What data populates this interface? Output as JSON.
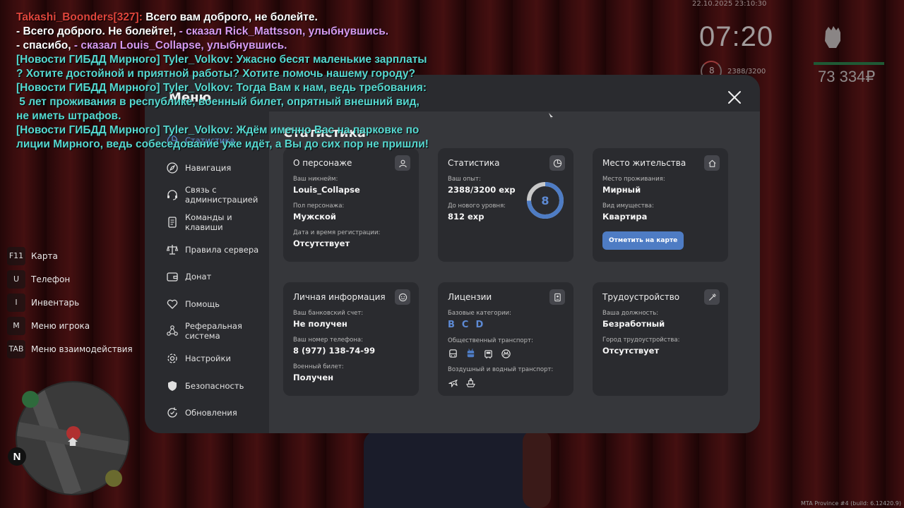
{
  "hud": {
    "datetime": "22.10.2025 23:10:30",
    "clock": "07:20",
    "level": "8",
    "exp": "2388/3200",
    "money": "73 334₽",
    "build": "MTA Province #4 (build: 6.12420.9)"
  },
  "chat": [
    {
      "parts": [
        {
          "text": "Takashi_Boonders[327]: ",
          "color": "red"
        },
        {
          "text": "Всего вам доброго, не болейте.",
          "color": "white"
        }
      ]
    },
    {
      "parts": [
        {
          "text": "- Всего доброго. Не болейте!, ",
          "color": "white"
        },
        {
          "text": "- сказал Rick_Mattsson, улыбнувшись.",
          "color": "purple"
        }
      ]
    },
    {
      "parts": [
        {
          "text": "- спасибо, ",
          "color": "white"
        },
        {
          "text": "- сказал Louis_Collapse, улыбнувшись.",
          "color": "purple"
        }
      ]
    },
    {
      "parts": [
        {
          "text": "[Новости ГИБДД Мирного] Tyler_Volkov: Ужасно бесят маленькие зарплаты",
          "color": "cyan"
        }
      ]
    },
    {
      "parts": [
        {
          "text": "? Хотите достойной и приятной работы? Хотите помочь нашему городу?",
          "color": "cyan"
        }
      ]
    },
    {
      "parts": [
        {
          "text": "[Новости ГИБДД Мирного] Tyler_Volkov: Тогда Вам к нам, ведь требования:",
          "color": "cyan"
        }
      ]
    },
    {
      "parts": [
        {
          "text": " 5 лет проживания в республике, военный билет, опрятный внешний вид,",
          "color": "cyan"
        }
      ]
    },
    {
      "parts": [
        {
          "text": "не иметь штрафов.",
          "color": "cyan"
        }
      ]
    },
    {
      "parts": [
        {
          "text": "[Новости ГИБДД Мирного] Tyler_Volkov: Ждём именно Вас на парковке по",
          "color": "cyan"
        }
      ]
    },
    {
      "parts": [
        {
          "text": "лиции Мирного, ведь собеседование уже идёт, а Вы до сих пор не пришли!",
          "color": "cyan"
        }
      ]
    }
  ],
  "hints": [
    {
      "key": "F11",
      "label": "Карта"
    },
    {
      "key": "U",
      "label": "Телефон"
    },
    {
      "key": "I",
      "label": "Инвентарь"
    },
    {
      "key": "M",
      "label": "Меню игрока"
    },
    {
      "key": "TAB",
      "label": "Меню взаимодействия"
    }
  ],
  "minimap": {
    "north": "N"
  },
  "menu": {
    "title": "Меню",
    "section_title": "Статистика",
    "sidebar": [
      {
        "label": "Статистика",
        "icon": "pie-chart-icon",
        "active": true
      },
      {
        "label": "Навигация",
        "icon": "compass-icon"
      },
      {
        "label": "Связь с администрацией",
        "icon": "headset-icon"
      },
      {
        "label": "Команды и клавиши",
        "icon": "document-icon"
      },
      {
        "label": "Правила сервера",
        "icon": "scales-icon"
      },
      {
        "label": "Донат",
        "icon": "wallet-icon"
      },
      {
        "label": "Помощь",
        "icon": "heart-hand-icon"
      },
      {
        "label": "Реферальная система",
        "icon": "network-icon"
      },
      {
        "label": "Настройки",
        "icon": "gear-icon"
      },
      {
        "label": "Безопасность",
        "icon": "shield-icon"
      },
      {
        "label": "Обновления",
        "icon": "refresh-icon"
      }
    ],
    "cards": {
      "persona": {
        "title": "О персонаже",
        "fields": [
          {
            "label": "Ваш никнейм:",
            "value": "Louis_Collapse"
          },
          {
            "label": "Пол персонажа:",
            "value": "Мужской"
          },
          {
            "label": "Дата и время регистрации:",
            "value": "Отсутствует"
          }
        ]
      },
      "stats": {
        "title": "Статистика",
        "fields": [
          {
            "label": "Ваш опыт:",
            "value": "2388/3200 exp"
          },
          {
            "label": "До нового уровня:",
            "value": "812 exp"
          }
        ],
        "level": "8",
        "progress": 0.746
      },
      "residence": {
        "title": "Место жительства",
        "fields": [
          {
            "label": "Место проживания:",
            "value": "Мирный"
          },
          {
            "label": "Вид имущества:",
            "value": "Квартира"
          }
        ],
        "button": "Отметить на карте"
      },
      "personal": {
        "title": "Личная информация",
        "fields": [
          {
            "label": "Ваш банковский счет:",
            "value": "Не получен"
          },
          {
            "label": "Ваш номер телефона:",
            "value": "8 (977) 138-74-99"
          },
          {
            "label": "Военный билет:",
            "value": "Получен"
          }
        ]
      },
      "licenses": {
        "title": "Лицензии",
        "base_label": "Базовые категории:",
        "categories": [
          "B",
          "C",
          "D"
        ],
        "public_label": "Общественный транспорт:",
        "public_icons": [
          "bus-icon",
          "trolleybus-icon",
          "tram-icon",
          "metro-icon"
        ],
        "air_label": "Воздушный и водный транспорт:",
        "air_icons": [
          "plane-icon",
          "boat-icon"
        ]
      },
      "job": {
        "title": "Трудоустройство",
        "fields": [
          {
            "label": "Ваша должность:",
            "value": "Безработный"
          },
          {
            "label": "Город трудоустройства:",
            "value": "Отсутствует"
          }
        ]
      }
    }
  }
}
